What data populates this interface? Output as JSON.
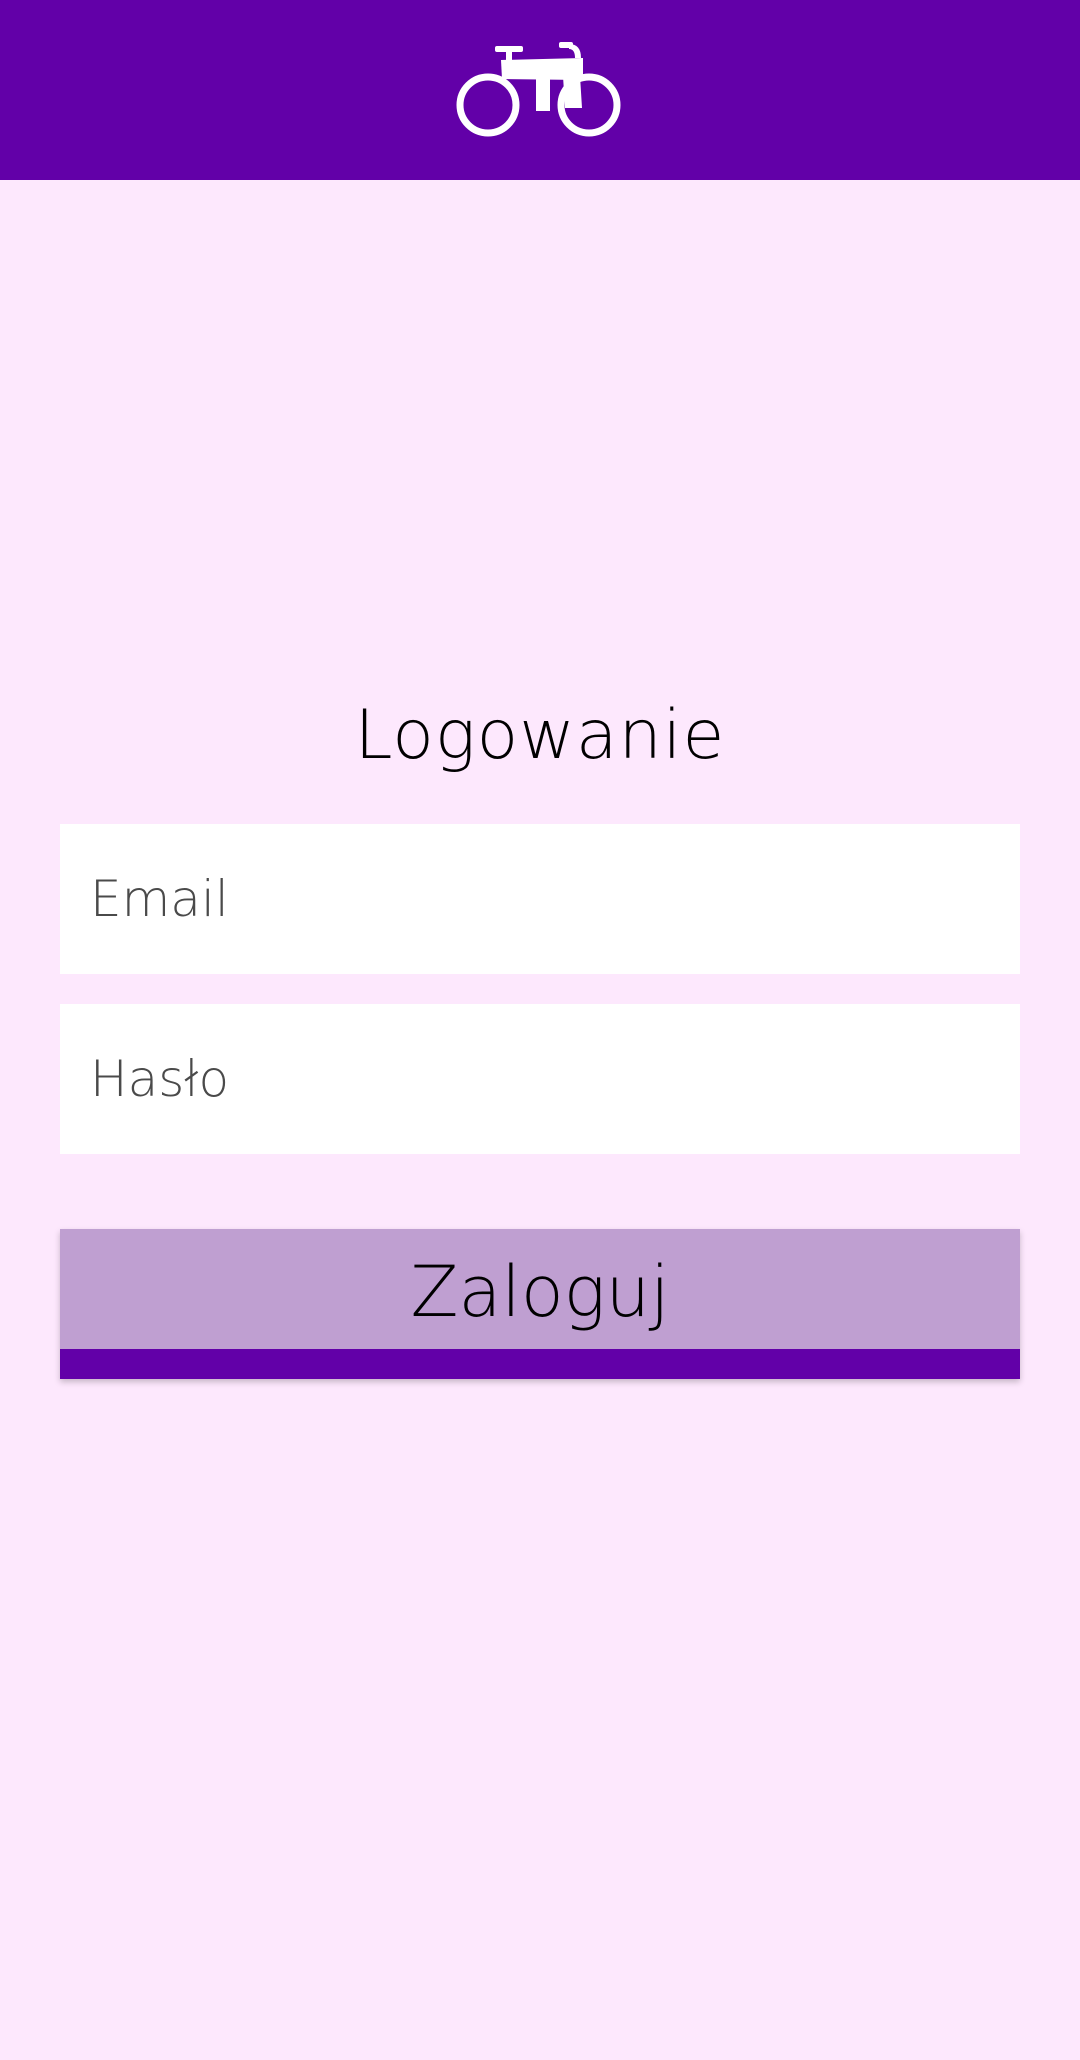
{
  "colors": {
    "header_bg": "#6200a8",
    "page_bg": "#fde8fd",
    "button_bg": "#bf9fd1",
    "button_accent": "#6200a8",
    "field_bg": "#ffffff"
  },
  "header": {
    "logo_icon": "bicycle-icon"
  },
  "login": {
    "title": "Logowanie",
    "email_placeholder": "Email",
    "password_placeholder": "Hasło",
    "submit_label": "Zaloguj"
  }
}
